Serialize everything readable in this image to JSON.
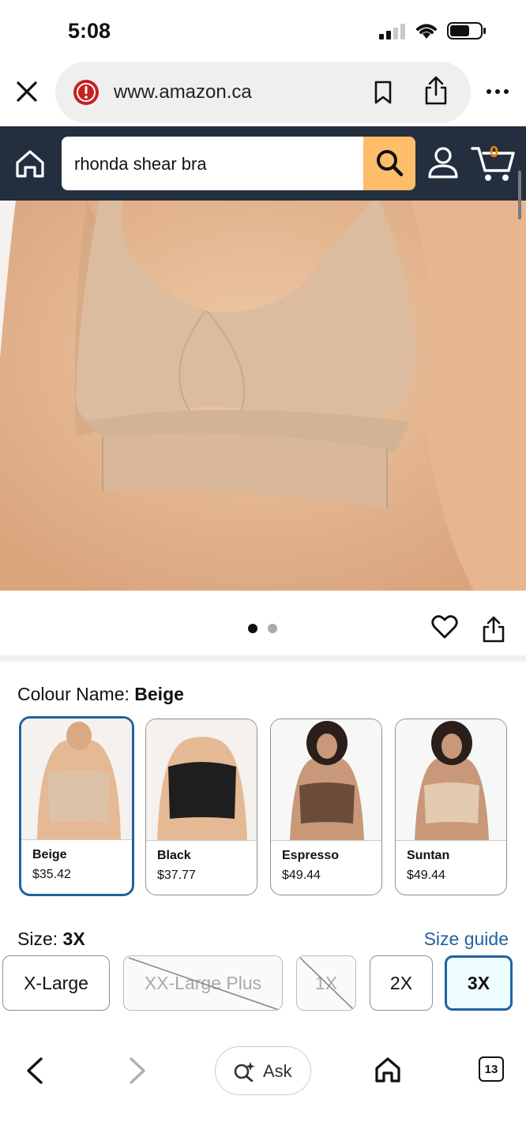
{
  "status_bar": {
    "time": "5:08"
  },
  "browser": {
    "url": "www.amazon.ca"
  },
  "header": {
    "search_value": "rhonda shear bra",
    "cart_count": "0"
  },
  "product": {
    "colour_prefix": "Colour Name: ",
    "colour_value": "Beige",
    "swatches": [
      {
        "name": "Beige",
        "price": "$35.42",
        "color": "#dcc3a8"
      },
      {
        "name": "Black",
        "price": "$37.77",
        "color": "#1e1e1e"
      },
      {
        "name": "Espresso",
        "price": "$49.44",
        "color": "#6b4b3a"
      },
      {
        "name": "Suntan",
        "price": "$49.44",
        "color": "#e2cbb0"
      }
    ],
    "size_prefix": "Size: ",
    "size_value": "3X",
    "size_guide": "Size guide",
    "sizes": [
      "X-Large",
      "XX-Large Plus",
      "1X",
      "2X",
      "3X"
    ]
  },
  "bottom_bar": {
    "ask_label": "Ask",
    "tab_count": "13"
  },
  "colors": {
    "amazon_navy": "#232f3e",
    "search_orange": "#febd69",
    "link_blue": "#2162a1"
  }
}
